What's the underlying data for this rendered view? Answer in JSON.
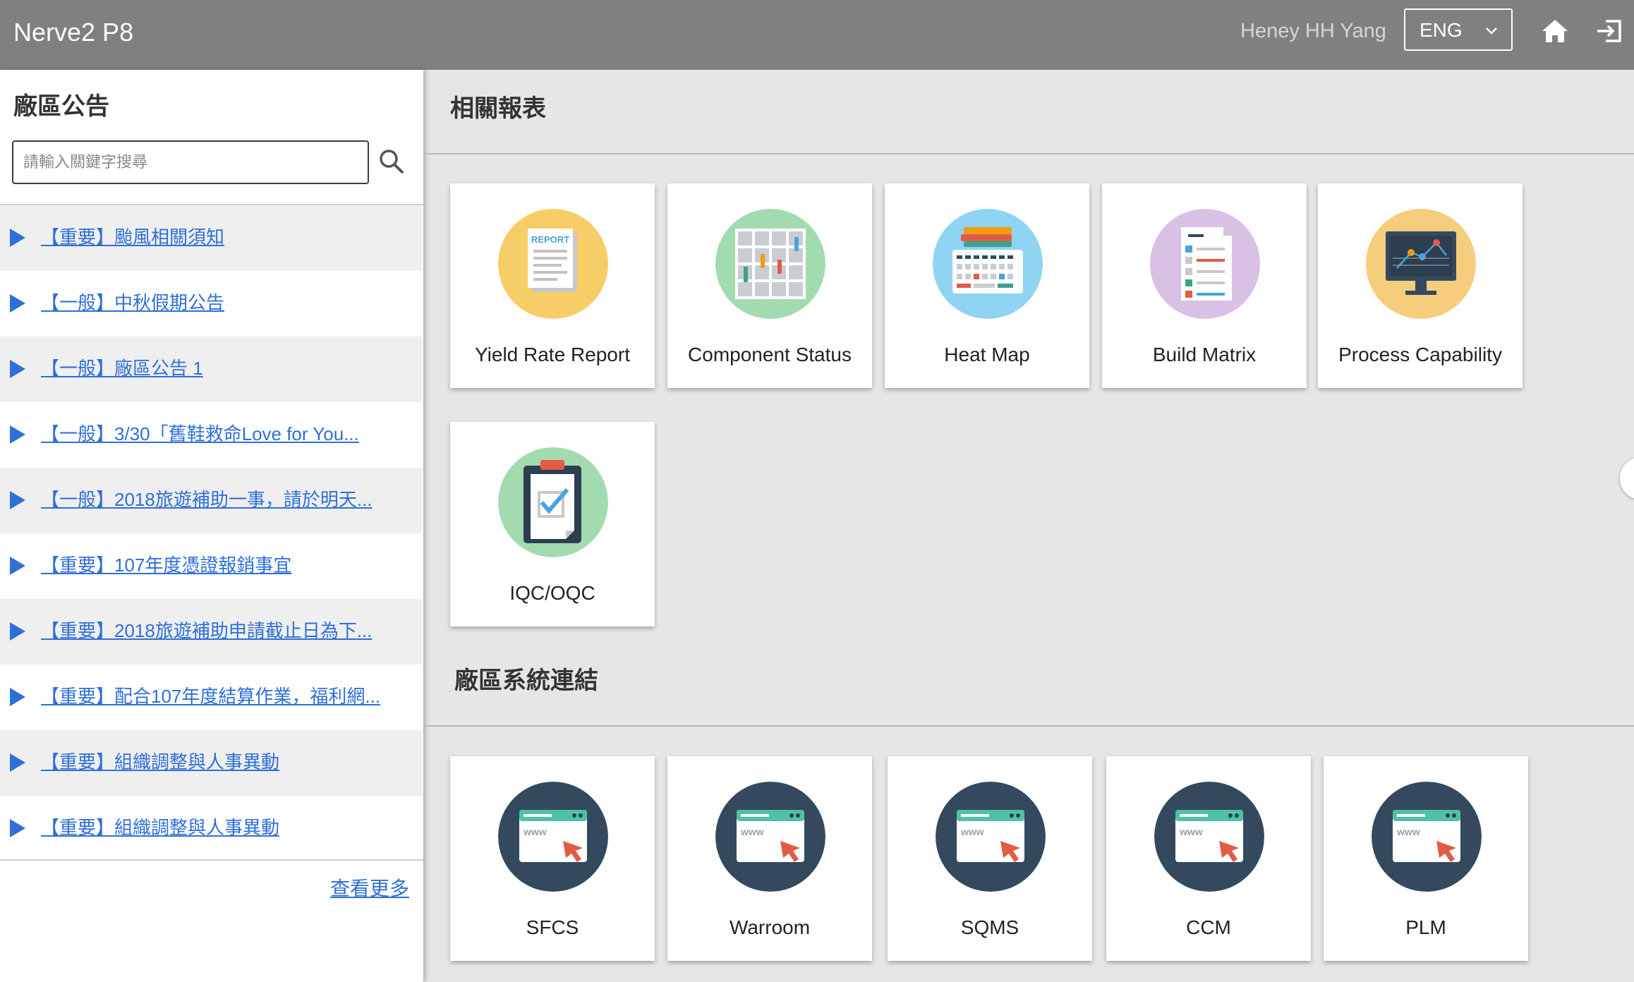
{
  "header": {
    "app_title": "Nerve2 P8",
    "user_name": "Heney HH Yang",
    "language": "ENG",
    "icons": [
      "chevron-down-icon",
      "home-icon",
      "logout-icon"
    ]
  },
  "sidebar": {
    "title": "廠區公告",
    "search_placeholder": "請輸入關鍵字搜尋",
    "items": [
      {
        "label": "【重要】颱風相關須知"
      },
      {
        "label": "【一般】中秋假期公告"
      },
      {
        "label": "【一般】廠區公告 1"
      },
      {
        "label": "【一般】3/30「舊鞋救命Love for You..."
      },
      {
        "label": "【一般】2018旅遊補助一事，請於明天..."
      },
      {
        "label": "【重要】107年度憑證報銷事宜"
      },
      {
        "label": "【重要】2018旅遊補助申請截止日為下..."
      },
      {
        "label": "【重要】配合107年度結算作業，福利網..."
      },
      {
        "label": "【重要】組織調整與人事異動"
      },
      {
        "label": "【重要】組織調整與人事異動"
      }
    ],
    "more_label": "查看更多"
  },
  "reports": {
    "title": "相關報表",
    "cards": [
      {
        "label": "Yield Rate Report",
        "icon": "report-icon",
        "color": "#f6cd66"
      },
      {
        "label": "Component Status",
        "icon": "component-grid-icon",
        "color": "#a3dbb0"
      },
      {
        "label": "Heat Map",
        "icon": "heat-map-icon",
        "color": "#8fd4f3"
      },
      {
        "label": "Build Matrix",
        "icon": "build-matrix-icon",
        "color": "#d9c1e6"
      },
      {
        "label": "Process Capability",
        "icon": "monitor-chart-icon",
        "color": "#f6cd7c"
      },
      {
        "label": "IQC/OQC",
        "icon": "clipboard-check-icon",
        "color": "#a3dbb0"
      }
    ]
  },
  "links": {
    "title": "廠區系統連結",
    "cards": [
      {
        "label": "SFCS",
        "icon": "web-browser-icon",
        "color": "#34495e"
      },
      {
        "label": "Warroom",
        "icon": "web-browser-icon",
        "color": "#34495e"
      },
      {
        "label": "SQMS",
        "icon": "web-browser-icon",
        "color": "#34495e"
      },
      {
        "label": "CCM",
        "icon": "web-browser-icon",
        "color": "#34495e"
      },
      {
        "label": "PLM",
        "icon": "web-browser-icon",
        "color": "#34495e"
      }
    ]
  }
}
